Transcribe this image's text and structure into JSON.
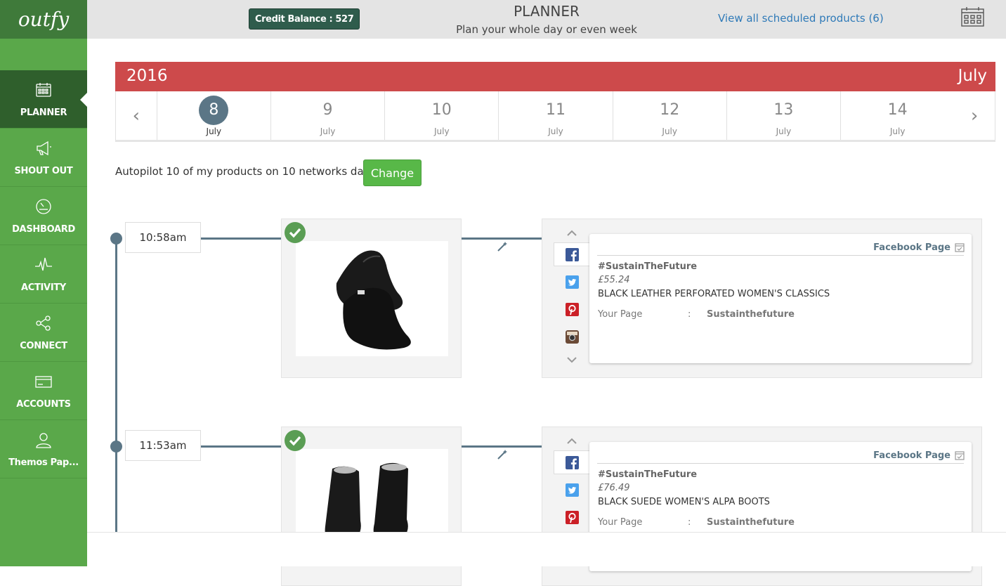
{
  "brand": {
    "logo_text": "outfy"
  },
  "sidebar": {
    "items": [
      {
        "label": "PLANNER",
        "icon": "calendar-icon",
        "active": true
      },
      {
        "label": "SHOUT OUT",
        "icon": "megaphone-icon"
      },
      {
        "label": "DASHBOARD",
        "icon": "gauge-icon"
      },
      {
        "label": "ACTIVITY",
        "icon": "pulse-icon"
      },
      {
        "label": "CONNECT",
        "icon": "share-icon"
      },
      {
        "label": "ACCOUNTS",
        "icon": "card-icon"
      },
      {
        "label": "Themos Pap...",
        "icon": "user-icon"
      }
    ]
  },
  "header": {
    "credit": "Credit Balance : 527",
    "title": "PLANNER",
    "subtitle": "Plan your whole day or even week",
    "scheduled_link": "View all scheduled products (6)",
    "calendar_icon": "calendar-icon"
  },
  "calendar": {
    "year": "2016",
    "month": "July",
    "days": [
      {
        "num": "8",
        "month": "July",
        "active": true
      },
      {
        "num": "9",
        "month": "July"
      },
      {
        "num": "10",
        "month": "July"
      },
      {
        "num": "11",
        "month": "July"
      },
      {
        "num": "12",
        "month": "July"
      },
      {
        "num": "13",
        "month": "July"
      },
      {
        "num": "14",
        "month": "July"
      }
    ]
  },
  "autopilot": {
    "text": "Autopilot 10 of my products on 10 networks daily.",
    "change_label": "Change"
  },
  "posts": [
    {
      "time": "10:58am",
      "network": "Facebook Page",
      "hashtag": "#SustainTheFuture",
      "price": "£55.24",
      "product": "BLACK LEATHER PERFORATED WOMEN'S CLASSICS",
      "page_label": "Your Page",
      "page_sep": ":",
      "page_value": "Sustainthefuture"
    },
    {
      "time": "11:53am",
      "network": "Facebook Page",
      "hashtag": "#SustainTheFuture",
      "price": "£76.49",
      "product": "BLACK SUEDE WOMEN'S ALPA BOOTS",
      "page_label": "Your Page",
      "page_sep": ":",
      "page_value": "Sustainthefuture"
    }
  ],
  "colors": {
    "sidebar": "#5aa84a",
    "sidebar_active": "#2f5f2c",
    "calendar_band": "#cd4a4b",
    "accent": "#5b7686",
    "button": "#58b848",
    "link": "#2f7ab8"
  }
}
